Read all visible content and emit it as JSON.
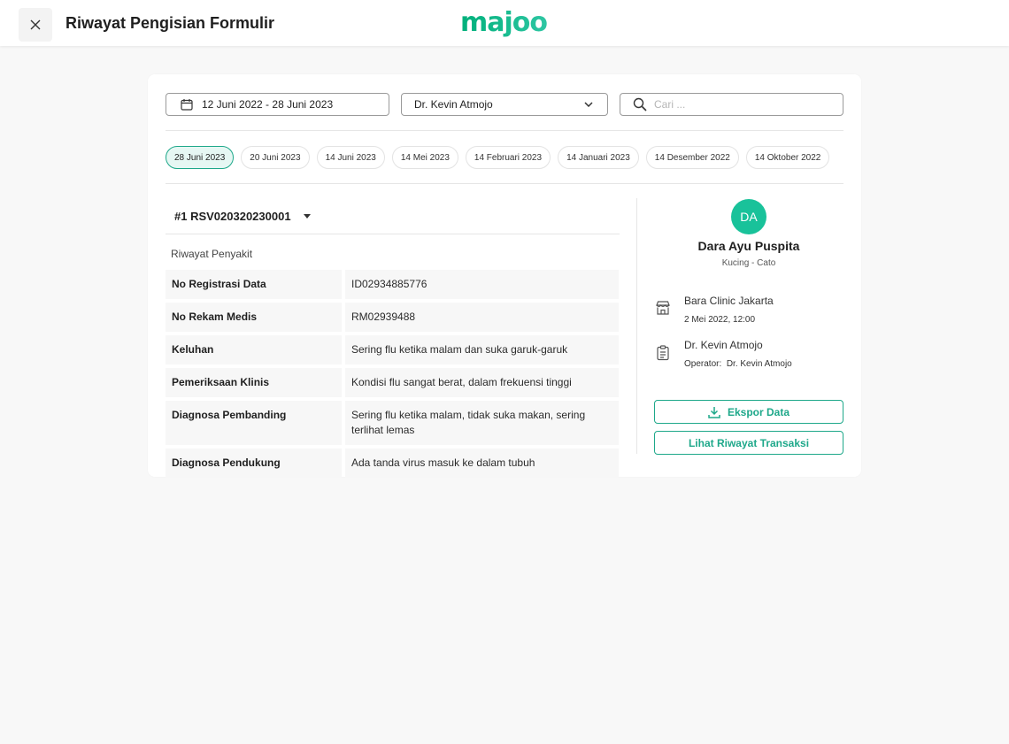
{
  "header": {
    "title": "Riwayat Pengisian Formulir",
    "logo": "majoo"
  },
  "filters": {
    "date_range": "12 Juni 2022 - 28 Juni 2023",
    "doctor": "Dr. Kevin Atmojo",
    "search_placeholder": "Cari ..."
  },
  "date_chips": [
    {
      "label": "28 Juni 2023",
      "active": true
    },
    {
      "label": "20 Juni 2023",
      "active": false
    },
    {
      "label": "14 Juni 2023",
      "active": false
    },
    {
      "label": "14 Mei 2023",
      "active": false
    },
    {
      "label": "14 Februari 2023",
      "active": false
    },
    {
      "label": "14 Januari 2023",
      "active": false
    },
    {
      "label": "14 Desember 2022",
      "active": false
    },
    {
      "label": "14 Oktober 2022",
      "active": false
    }
  ],
  "record": {
    "id": "#1 RSV020320230001",
    "section_title": "Riwayat Penyakit",
    "rows": [
      {
        "label": "No Registrasi Data",
        "value": "ID02934885776"
      },
      {
        "label": "No Rekam Medis",
        "value": "RM02939488"
      },
      {
        "label": "Keluhan",
        "value": "Sering flu ketika malam dan suka garuk-garuk"
      },
      {
        "label": "Pemeriksaan Klinis",
        "value": "Kondisi flu sangat berat, dalam frekuensi tinggi"
      },
      {
        "label": "Diagnosa Pembanding",
        "value": "Sering flu ketika malam, tidak suka makan, sering terlihat lemas"
      },
      {
        "label": "Diagnosa Pendukung",
        "value": "Ada tanda virus masuk ke dalam tubuh"
      }
    ]
  },
  "patient": {
    "initials": "DA",
    "name": "Dara Ayu Puspita",
    "species": "Kucing - Cato",
    "clinic": "Bara Clinic Jakarta",
    "visit_time": "2 Mei 2022, 12:00",
    "doctor": "Dr. Kevin Atmojo",
    "operator_label": "Operator:",
    "operator": "Dr. Kevin Atmojo"
  },
  "actions": {
    "export_label": "Ekspor Data",
    "transactions_label": "Lihat Riwayat Transaksi"
  },
  "colors": {
    "accent": "#1ea88a",
    "avatar": "#19c29a",
    "chip_active_bg": "#e6f7f3"
  }
}
